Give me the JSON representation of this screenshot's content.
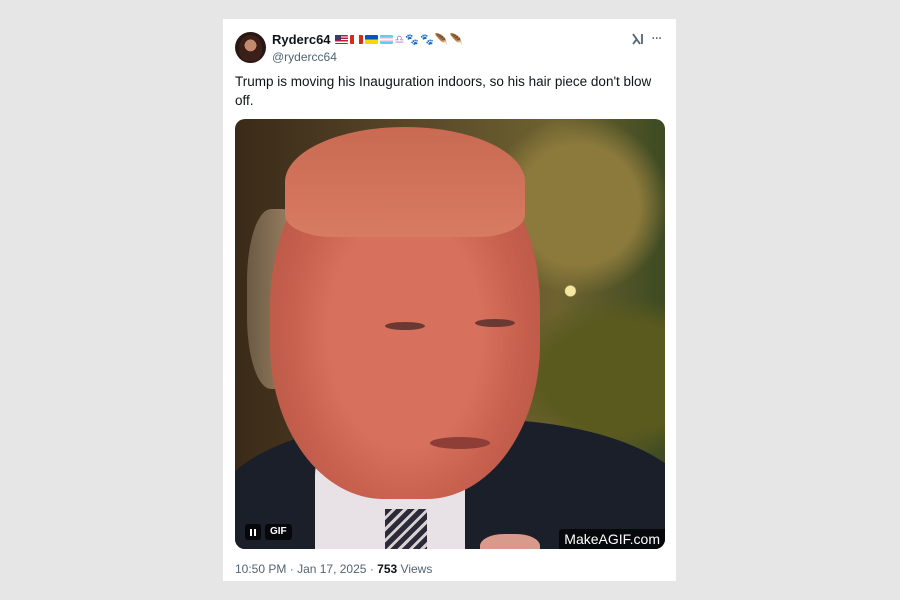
{
  "author": {
    "display_name": "Ryderc64",
    "handle": "@rydercc64",
    "badges": [
      {
        "icon": "us-flag-icon"
      },
      {
        "icon": "canada-flag-icon"
      },
      {
        "icon": "ukraine-flag-icon"
      },
      {
        "icon": "trans-flag-icon"
      },
      {
        "icon": "libra-emoji-icon",
        "glyph": "♎"
      },
      {
        "icon": "paw-prints-icon",
        "glyph": "🐾"
      },
      {
        "icon": "paw-prints-icon",
        "glyph": "🐾"
      },
      {
        "icon": "feather-icon",
        "glyph": "🪶"
      },
      {
        "icon": "feather-icon",
        "glyph": "🪶"
      }
    ]
  },
  "tweet": {
    "text": "Trump is moving his Inauguration indoors, so his hair piece don't blow off.",
    "time": "10:50 PM",
    "separator": "·",
    "date": "Jan 17, 2025",
    "views_count": "753",
    "views_label": "Views"
  },
  "media": {
    "gif_label": "GIF",
    "watermark": "MakeAGIF.com"
  },
  "icons": {
    "grok": "grok-icon",
    "more": "more-options-icon",
    "more_glyph": "···"
  },
  "colors": {
    "text_primary": "#0f1419",
    "text_secondary": "#536471",
    "page_background": "#e6e6e6",
    "card_background": "#ffffff"
  }
}
